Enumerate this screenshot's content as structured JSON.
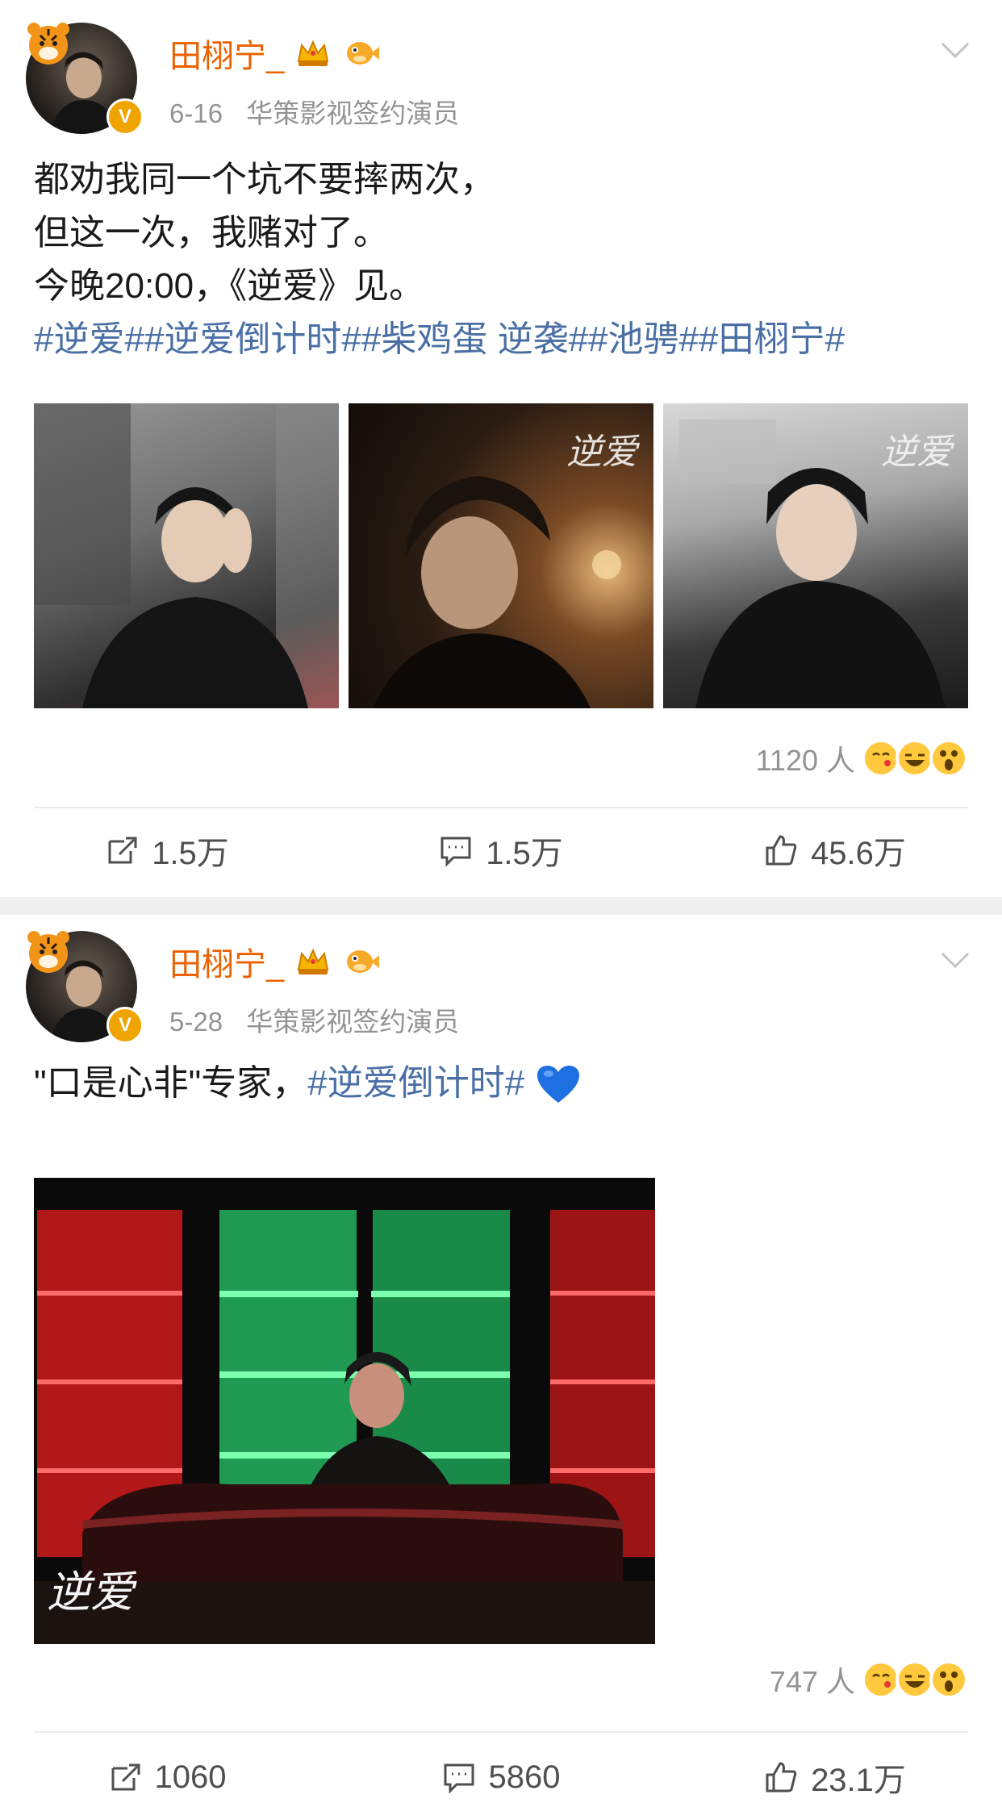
{
  "posts": [
    {
      "username": "田栩宁_",
      "date": "6-16",
      "source": "华策影视签约演员",
      "verified_badge": "V",
      "text_lines": [
        "都劝我同一个坑不要摔两次，",
        "但这一次，我赌对了。",
        "今晚20:00，《逆爱》见。"
      ],
      "hashtags_line": "#逆爱##逆爱倒计时##柴鸡蛋 逆袭##池骋##田栩宁#",
      "photo_watermark": "逆爱",
      "reaction_count": "1120 人",
      "actions": {
        "repost": "1.5万",
        "comment": "1.5万",
        "like": "45.6万"
      }
    },
    {
      "username": "田栩宁_",
      "date": "5-28",
      "source": "华策影视签约演员",
      "verified_badge": "V",
      "text_plain": "\"口是心非\"专家，",
      "text_hashtag": "#逆爱倒计时#",
      "photo_watermark": "逆爱",
      "reaction_count": "747 人",
      "actions": {
        "repost": "1060",
        "comment": "5860",
        "like": "23.1万"
      }
    }
  ],
  "icons": {
    "avatar_decoration": "tiger-icon",
    "crown_badge": "crown-icon",
    "pufferfish_badge": "pufferfish-icon",
    "menu": "chevron-down-icon",
    "repost": "repost-icon",
    "comment": "comment-icon",
    "like": "thumbs-up-icon",
    "heart": "blue-heart-icon"
  },
  "colors": {
    "username": "#eb6100",
    "hashtag": "#4a6fa5",
    "meta": "#939393",
    "verified": "#f0a400"
  }
}
